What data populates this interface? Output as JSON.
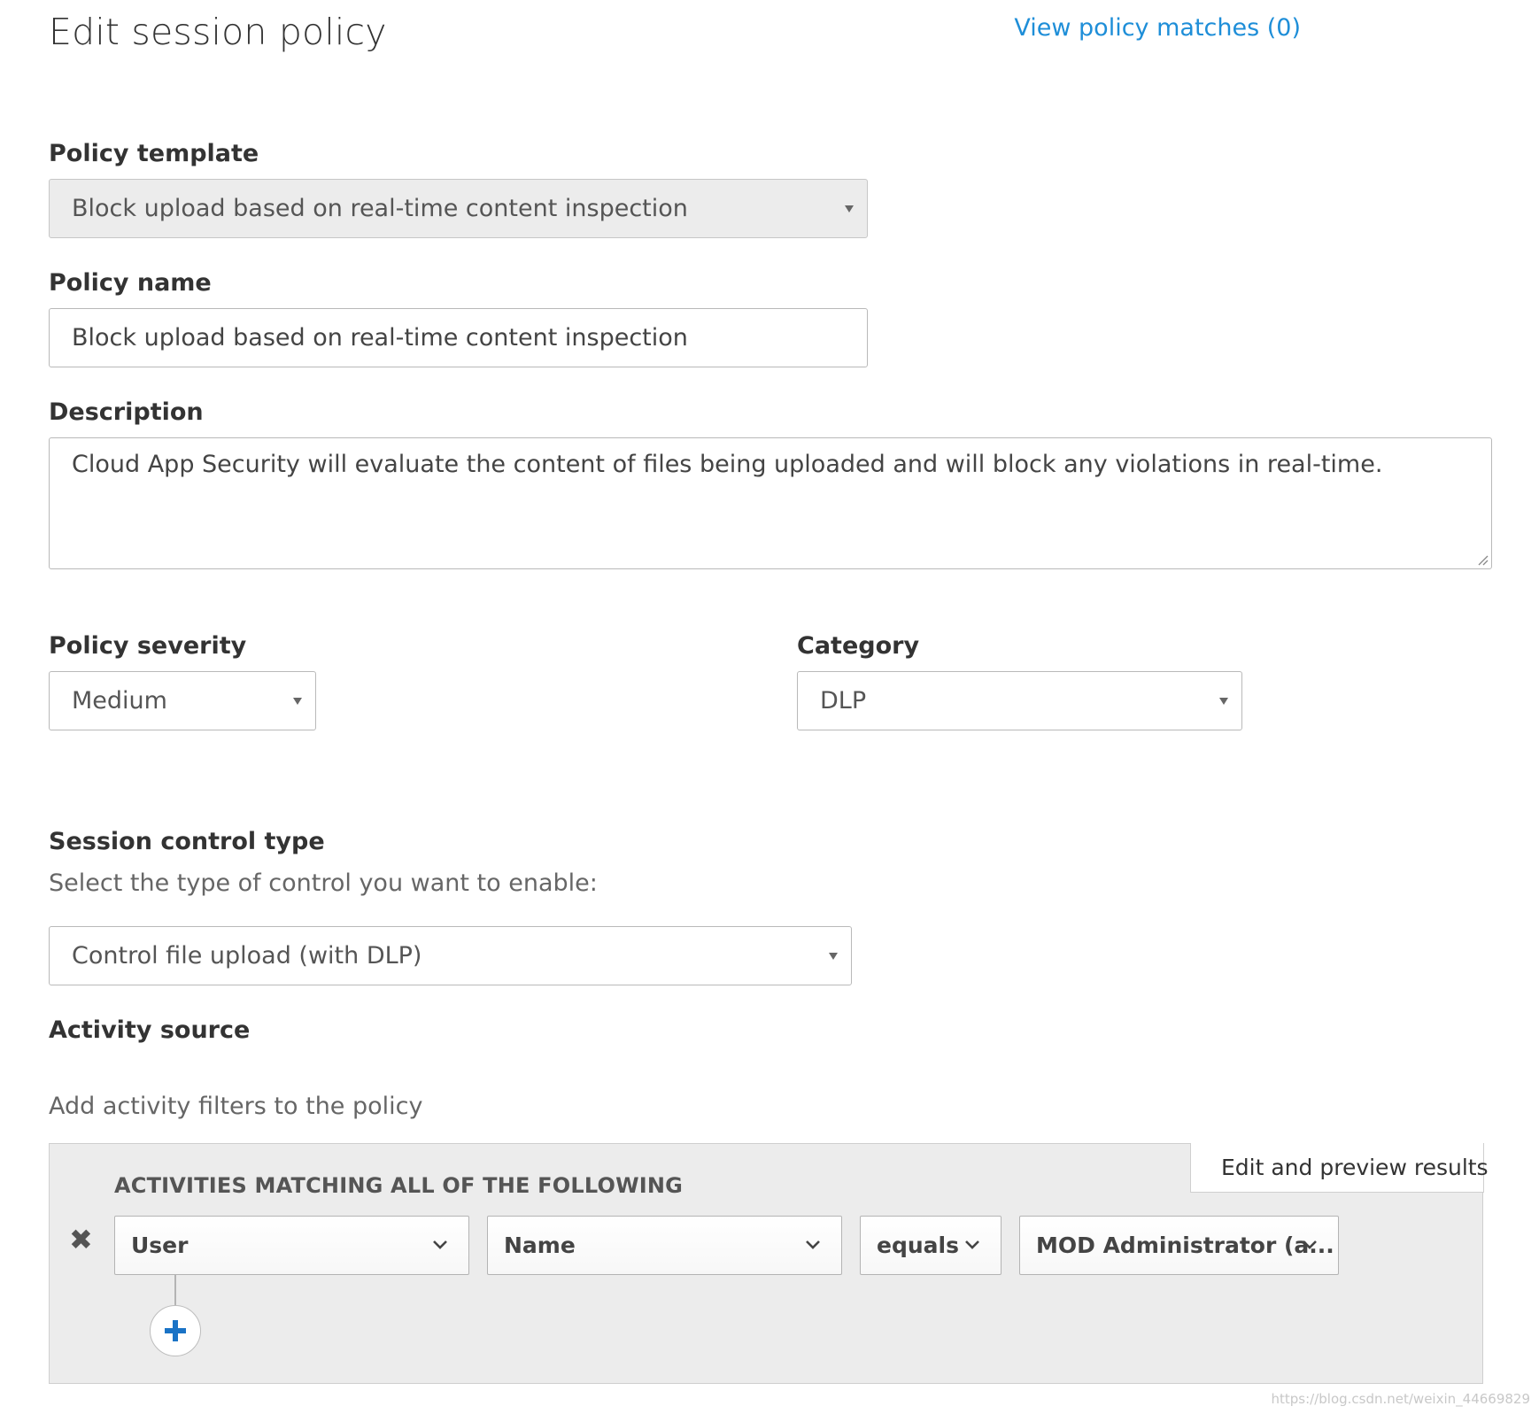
{
  "header": {
    "title": "Edit session policy",
    "matches_link": "View policy matches (0)"
  },
  "policy_template": {
    "label": "Policy template",
    "value": "Block upload based on real-time content inspection"
  },
  "policy_name": {
    "label": "Policy name",
    "value": "Block upload based on real-time content inspection"
  },
  "description": {
    "label": "Description",
    "value": "Cloud App Security will evaluate the content of files being uploaded and will block any violations in real-time."
  },
  "severity": {
    "label": "Policy severity",
    "value": "Medium"
  },
  "category": {
    "label": "Category",
    "value": "DLP"
  },
  "session_control": {
    "label": "Session control type",
    "helper": "Select the type of control you want to enable:",
    "value": "Control file upload (with DLP)"
  },
  "activity_source": {
    "label": "Activity source",
    "helper": "Add activity filters to the policy",
    "edit_preview_label": "Edit and preview results",
    "matching_heading": "ACTIVITIES MATCHING ALL OF THE FOLLOWING",
    "filter": {
      "field": "User",
      "attribute": "Name",
      "operator": "equals",
      "value": "MOD Administrator (a..."
    }
  },
  "watermark": "https://blog.csdn.net/weixin_44669829",
  "colors": {
    "link": "#1e8ed8",
    "add_icon": "#1a73c6",
    "panel_bg": "#ececec"
  }
}
